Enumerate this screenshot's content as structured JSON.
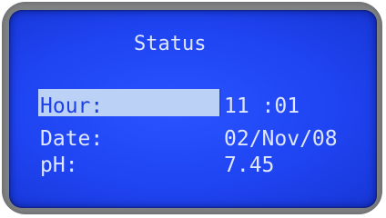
{
  "screen": {
    "title": "Status",
    "rows": [
      {
        "label": "Hour:",
        "value": "11 :01",
        "selected": true
      },
      {
        "label": "Date:",
        "value": "02/Nov/08",
        "selected": false
      },
      {
        "label": "pH:",
        "value": "7.45",
        "selected": false
      }
    ]
  },
  "colors": {
    "lcd_background": "#1f44f2",
    "lcd_text": "#dfe6ff",
    "highlight": "#bcd1f6",
    "bezel": "#7f8183"
  }
}
